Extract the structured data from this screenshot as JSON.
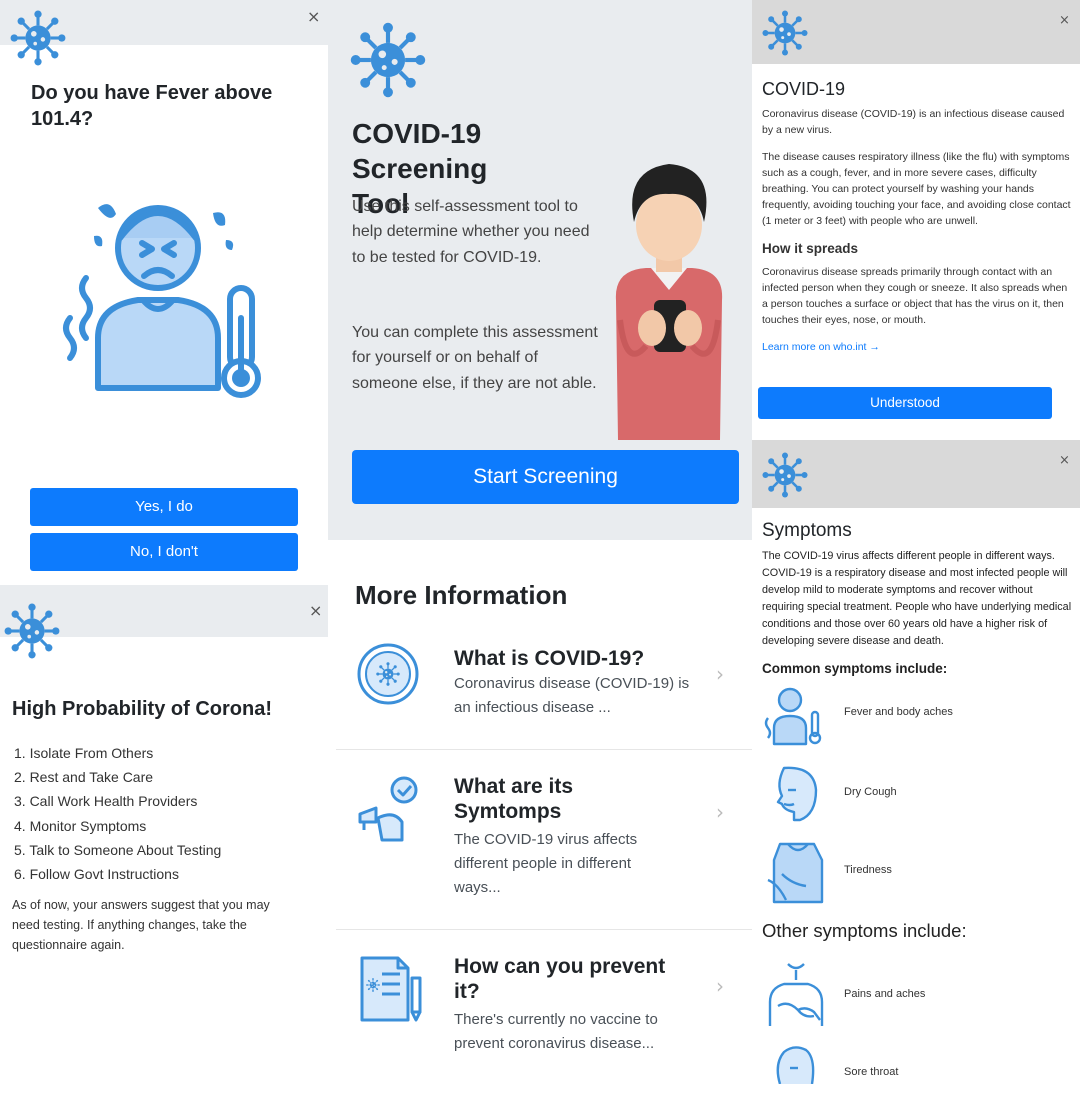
{
  "close_glyph": "×",
  "colors": {
    "accent": "#0d7bfd",
    "header_gray": "#e9ecef",
    "icon_blue": "#3b8fd9"
  },
  "fever": {
    "question": "Do you have Fever above 101.4?",
    "yes_label": "Yes, I do",
    "no_label": "No, I don't"
  },
  "intro": {
    "title": "COVID-19 Screening Tool",
    "paragraph1": "Use this self-assessment tool to help determine whether you need to be tested for COVID-19.",
    "paragraph2": "You can complete this assessment for yourself or on behalf of someone else, if they are not able.",
    "start_label": "Start Screening"
  },
  "result": {
    "title": "High Probability of Corona!",
    "steps": [
      "1. Isolate From Others",
      "2. Rest and Take Care",
      "3. Call Work Health Providers",
      "4. Monitor Symptoms",
      "5. Talk to Someone About Testing",
      "6. Follow Govt Instructions"
    ],
    "note": "As of now, your answers suggest that you may need testing. If anything changes, take the questionnaire again."
  },
  "more_info": {
    "heading": "More Information",
    "items": [
      {
        "title": "What is COVID-19?",
        "desc": "Coronavirus disease (COVID-19) is an infectious disease ...",
        "icon": "virus-petri-icon"
      },
      {
        "title": "What are its Symtomps",
        "desc": "The COVID-19 virus affects different people in different ways...",
        "icon": "thermometer-check-icon"
      },
      {
        "title": "How can you prevent it?",
        "desc": "There's currently no vaccine to prevent coronavirus disease...",
        "icon": "document-pencil-icon"
      }
    ]
  },
  "about": {
    "title": "COVID-19",
    "p1": "Coronavirus disease (COVID-19) is an infectious disease caused by a new virus.",
    "p2": "The disease causes respiratory illness (like the flu) with symptoms such as a cough, fever, and in more severe cases, difficulty breathing. You can protect yourself by washing your hands frequently, avoiding touching your face, and avoiding close contact (1 meter or 3 feet) with people who are unwell.",
    "spreads_title": "How it spreads",
    "p3": "Coronavirus disease spreads primarily through contact with an infected person when they cough or sneeze. It also spreads when a person touches a surface or object that has the virus on it, then touches their eyes, nose, or mouth.",
    "link": "Learn more on who.int →",
    "understood_label": "Understood"
  },
  "symptoms": {
    "title": "Symptoms",
    "intro": "The COVID-19 virus affects different people in different ways. COVID-19 is a respiratory disease and most infected people will develop mild to moderate symptoms and recover without requiring special treatment. People who have underlying medical conditions and those over 60 years old have a higher risk of developing severe disease and death.",
    "common_title": "Common symptoms include:",
    "common": [
      {
        "label": "Fever and body aches",
        "icon": "fever-person-icon"
      },
      {
        "label": "Dry Cough",
        "icon": "cough-face-icon"
      },
      {
        "label": "Tiredness",
        "icon": "tired-person-icon"
      }
    ],
    "other_title": "Other symptoms include:",
    "other": [
      {
        "label": "Pains and aches",
        "icon": "pain-person-icon"
      },
      {
        "label": "Sore throat",
        "icon": "sore-throat-icon"
      }
    ]
  }
}
